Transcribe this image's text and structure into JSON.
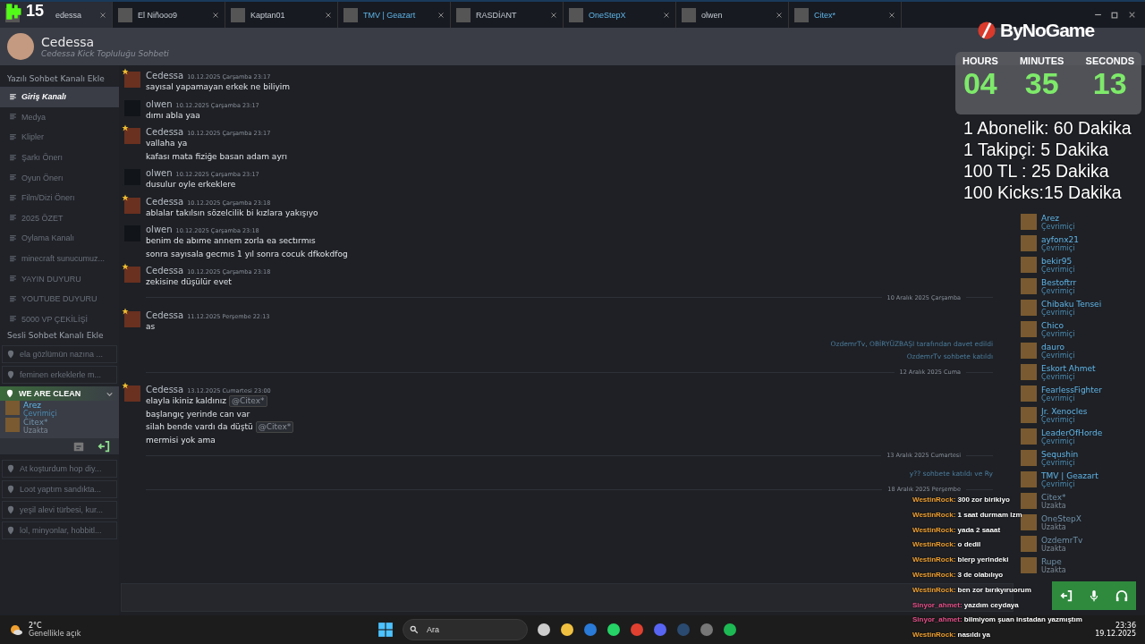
{
  "tabs": [
    {
      "label": "edessa",
      "selected": true,
      "unread": false
    },
    {
      "label": "El Niñooo9",
      "selected": false,
      "unread": false
    },
    {
      "label": "Kaptan01",
      "selected": false,
      "unread": false
    },
    {
      "label": "TMV | Geazart",
      "selected": false,
      "unread": true
    },
    {
      "label": "RASDİANT",
      "selected": false,
      "unread": false
    },
    {
      "label": "OneStepX",
      "selected": false,
      "unread": true
    },
    {
      "label": "olwen",
      "selected": false,
      "unread": false
    },
    {
      "label": "Citex*",
      "selected": false,
      "unread": true
    }
  ],
  "header": {
    "title": "Cedessa",
    "subtitle": "Cedessa Kick Topluluğu Sohbeti"
  },
  "sidebar": {
    "text_heading": "Yazılı Sohbet Kanalı Ekle",
    "text_channels": [
      {
        "label": "Giriş Kanalı",
        "selected": true
      },
      {
        "label": "Medya",
        "selected": false
      },
      {
        "label": "Klipler",
        "selected": false
      },
      {
        "label": "Şarkı Önerı",
        "selected": false
      },
      {
        "label": "Oyun Önerı",
        "selected": false
      },
      {
        "label": "Film/Dizi Önerı",
        "selected": false
      },
      {
        "label": "2025 ÖZET",
        "selected": false
      },
      {
        "label": "Oylama Kanalı",
        "selected": false
      },
      {
        "label": "minecraft sunucumuz...",
        "selected": false
      },
      {
        "label": "YAYIN DUYURU",
        "selected": false
      },
      {
        "label": "YOUTUBE DUYURU",
        "selected": false
      },
      {
        "label": "5000 VP ÇEKİLİŞİ",
        "selected": false
      }
    ],
    "voice_heading": "Sesli Sohbet Kanalı Ekle",
    "voice_channels": [
      {
        "label": "ela gözlümün nazına ...",
        "expanded": false
      },
      {
        "label": "feminen erkeklerle m...",
        "expanded": false
      },
      {
        "label": "WE ARE CLEAN",
        "expanded": true,
        "members": [
          {
            "name": "Arez",
            "status": "Çevrimiçi",
            "online": true
          },
          {
            "name": "Citex*",
            "status": "Uzakta",
            "online": false
          }
        ]
      },
      {
        "label": "At koşturdum hop diy...",
        "expanded": false
      },
      {
        "label": "Loot yaptım sandıkta...",
        "expanded": false
      },
      {
        "label": "yeşil alevi türbesi, kur...",
        "expanded": false
      },
      {
        "label": "lol, minyonlar, hobbitl...",
        "expanded": false
      }
    ]
  },
  "chat": {
    "items": [
      {
        "kind": "message",
        "author": "Cedessa",
        "owner": true,
        "time": "10.12.2025 Çarşamba 23:17",
        "lines": [
          {
            "text": "sayısal yapamayan erkek ne biliyim"
          }
        ]
      },
      {
        "kind": "message",
        "author": "olwen",
        "owner": false,
        "time": "10.12.2025 Çarşamba 23:17",
        "lines": [
          {
            "text": "dımı abla yaa"
          }
        ]
      },
      {
        "kind": "message",
        "author": "Cedessa",
        "owner": true,
        "time": "10.12.2025 Çarşamba 23:17",
        "lines": [
          {
            "text": "vallaha ya"
          },
          {
            "text": "kafası mata fiziğe basan adam ayrı"
          }
        ]
      },
      {
        "kind": "message",
        "author": "olwen",
        "owner": false,
        "time": "10.12.2025 Çarşamba 23:17",
        "lines": [
          {
            "text": "dusulur oyle erkeklere"
          }
        ]
      },
      {
        "kind": "message",
        "author": "Cedessa",
        "owner": true,
        "time": "10.12.2025 Çarşamba 23:18",
        "lines": [
          {
            "text": "ablalar takılsın sözelcilik bi kızlara yakışıyo"
          }
        ]
      },
      {
        "kind": "message",
        "author": "olwen",
        "owner": false,
        "time": "10.12.2025 Çarşamba 23:18",
        "lines": [
          {
            "text": "benim de abıme annem zorla ea sectırmıs"
          },
          {
            "text": "sonra sayısala gecmıs 1 yıl sonra cocuk dfkokdfog"
          }
        ]
      },
      {
        "kind": "message",
        "author": "Cedessa",
        "owner": true,
        "time": "10.12.2025 Çarşamba 23:18",
        "lines": [
          {
            "text": "zekisine düşülür evet"
          }
        ]
      },
      {
        "kind": "divider",
        "label": "10 Aralık 2025 Çarşamba"
      },
      {
        "kind": "message",
        "author": "Cedessa",
        "owner": true,
        "time": "11.12.2025 Perşembe 22:13",
        "lines": [
          {
            "text": "as"
          }
        ]
      },
      {
        "kind": "system",
        "text": "OzdemrTv, OBİRYÜZBAŞI tarafından davet edildi"
      },
      {
        "kind": "system",
        "text": "OzdemrTv sohbete katıldı"
      },
      {
        "kind": "divider",
        "label": "12 Aralık 2025 Cuma"
      },
      {
        "kind": "message",
        "author": "Cedessa",
        "owner": true,
        "time": "13.12.2025 Cumartesi 23:00",
        "lines": [
          {
            "text": "elayla ikiniz kaldınız",
            "mention": "@Citex*"
          },
          {
            "text": "başlangıç yerinde can var"
          },
          {
            "text": "silah bende vardı da düştü",
            "mention": "@Citex*"
          },
          {
            "text": "mermisi yok ama"
          }
        ]
      },
      {
        "kind": "divider",
        "label": "13 Aralık 2025 Cumartesi"
      },
      {
        "kind": "system",
        "text": "y?? sohbete katıldı ve Ry"
      },
      {
        "kind": "divider",
        "label": "18 Aralık 2025 Perşembe"
      }
    ]
  },
  "members": {
    "list": [
      {
        "name": "Arez",
        "status": "Çevrimiçi",
        "online": true
      },
      {
        "name": "ayfonx21",
        "status": "Çevrimiçi",
        "online": true
      },
      {
        "name": "bekir95",
        "status": "Çevrimiçi",
        "online": true
      },
      {
        "name": "Bestoftrr",
        "status": "Çevrimiçi",
        "online": true
      },
      {
        "name": "Chibaku Tensei",
        "status": "Çevrimiçi",
        "online": true
      },
      {
        "name": "Chico",
        "status": "Çevrimiçi",
        "online": true
      },
      {
        "name": "dauro",
        "status": "Çevrimiçi",
        "online": true
      },
      {
        "name": "Eskort Ahmet",
        "status": "Çevrimiçi",
        "online": true
      },
      {
        "name": "FearlessFighter",
        "status": "Çevrimiçi",
        "online": true
      },
      {
        "name": "Jr. Xenocles",
        "status": "Çevrimiçi",
        "online": true
      },
      {
        "name": "LeaderOfHorde",
        "status": "Çevrimiçi",
        "online": true
      },
      {
        "name": "Sequshin",
        "status": "Çevrimiçi",
        "online": true
      },
      {
        "name": "TMV | Geazart",
        "status": "Çevrimiçi",
        "online": true
      },
      {
        "name": "Citex*",
        "status": "Uzakta",
        "online": false
      },
      {
        "name": "OneStepX",
        "status": "Uzakta",
        "online": false
      },
      {
        "name": "OzdemrTv",
        "status": "Uzakta",
        "online": false
      },
      {
        "name": "Rupe",
        "status": "Uzakta",
        "online": false
      }
    ]
  },
  "overlay": {
    "viewer_count": "15",
    "brand": "ByNoGame",
    "timer": [
      {
        "unit": "HOURS",
        "value": "04"
      },
      {
        "unit": "MINUTES",
        "value": "35"
      },
      {
        "unit": "SECONDS",
        "value": "13"
      }
    ],
    "rates": [
      "1 Abonelik: 60 Dakika",
      "1 Takipçi: 5 Dakika",
      "100 TL : 25 Dakika",
      "100 Kicks:15 Dakika"
    ],
    "stream_chat": [
      {
        "user": "WestinRock:",
        "text": "300 zor birikiyo",
        "color": "#f0a030"
      },
      {
        "user": "WestinRock:",
        "text": "1 saat durmam lzm",
        "color": "#f0a030"
      },
      {
        "user": "WestinRock:",
        "text": "yada 2 saaat",
        "color": "#f0a030"
      },
      {
        "user": "WestinRock:",
        "text": "o dedil",
        "color": "#f0a030"
      },
      {
        "user": "WestinRock:",
        "text": "blerp yerindeki",
        "color": "#f0a030"
      },
      {
        "user": "WestinRock:",
        "text": "3 de olabılıyo",
        "color": "#f0a030"
      },
      {
        "user": "WestinRock:",
        "text": "ben zor bırıkyıruorum",
        "color": "#f0a030"
      },
      {
        "user": "Sinyor_ahmet:",
        "text": "yazdım ceydaya",
        "color": "#e8508a"
      },
      {
        "user": "Sinyor_ahmet:",
        "text": "bilmiyom şuan instadan yazmıştım",
        "color": "#e8508a"
      },
      {
        "user": "WestinRock:",
        "text": "nasıldı ya",
        "color": "#f0a030"
      }
    ]
  },
  "taskbar": {
    "temperature": "2°C",
    "weather": "Genellikle açık",
    "search_placeholder": "Ara",
    "time": "23:36",
    "date": "19.12.2025"
  }
}
